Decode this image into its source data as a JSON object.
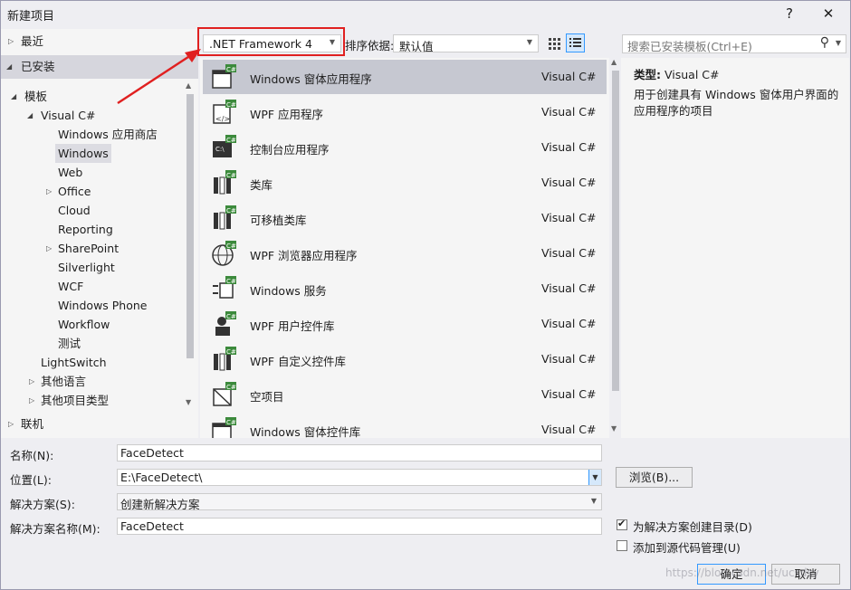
{
  "window": {
    "title": "新建项目",
    "help_label": "?",
    "close_label": "✕"
  },
  "tree": {
    "recent": "最近",
    "installed": "已安装",
    "templates": "模板",
    "visual_csharp": "Visual C#",
    "children": [
      "Windows 应用商店",
      "Windows",
      "Web",
      "Office",
      "Cloud",
      "Reporting",
      "SharePoint",
      "Silverlight",
      "WCF",
      "Windows Phone",
      "Workflow",
      "测试"
    ],
    "lightswitch": "LightSwitch",
    "other_languages": "其他语言",
    "other_project_types": "其他项目类型",
    "online": "联机"
  },
  "toolbar": {
    "framework": ".NET Framework 4",
    "sort_label": "排序依据:",
    "sort_value": "默认值",
    "search_placeholder": "搜索已安装模板(Ctrl+E)"
  },
  "templates": [
    {
      "name": "Windows 窗体应用程序",
      "lang": "Visual C#",
      "icon": "windows-forms-icon"
    },
    {
      "name": "WPF 应用程序",
      "lang": "Visual C#",
      "icon": "wpf-app-icon"
    },
    {
      "name": "控制台应用程序",
      "lang": "Visual C#",
      "icon": "console-app-icon"
    },
    {
      "name": "类库",
      "lang": "Visual C#",
      "icon": "class-library-icon"
    },
    {
      "name": "可移植类库",
      "lang": "Visual C#",
      "icon": "portable-library-icon"
    },
    {
      "name": "WPF 浏览器应用程序",
      "lang": "Visual C#",
      "icon": "wpf-browser-icon"
    },
    {
      "name": "Windows 服务",
      "lang": "Visual C#",
      "icon": "windows-service-icon"
    },
    {
      "name": "WPF 用户控件库",
      "lang": "Visual C#",
      "icon": "wpf-user-control-icon"
    },
    {
      "name": "WPF 自定义控件库",
      "lang": "Visual C#",
      "icon": "wpf-custom-control-icon"
    },
    {
      "name": "空项目",
      "lang": "Visual C#",
      "icon": "empty-project-icon"
    },
    {
      "name": "Windows 窗体控件库",
      "lang": "Visual C#",
      "icon": "forms-control-library-icon"
    }
  ],
  "details": {
    "type_label": "类型:",
    "type_value": "Visual C#",
    "description": "用于创建具有 Windows 窗体用户界面的应用程序的项目"
  },
  "form": {
    "name_label": "名称(N):",
    "name_value": "FaceDetect",
    "location_label": "位置(L):",
    "location_value": "E:\\FaceDetect\\",
    "browse_label": "浏览(B)...",
    "solution_label": "解决方案(S):",
    "solution_value": "创建新解决方案",
    "solution_name_label": "解决方案名称(M):",
    "solution_name_value": "FaceDetect",
    "create_dir_label": "为解决方案创建目录(D)",
    "create_dir_checked": true,
    "source_control_label": "添加到源代码管理(U)",
    "source_control_checked": false,
    "ok_label": "确定",
    "cancel_label": "取消"
  },
  "watermark": "https://blog.csdn.net/ucsdsy",
  "colors": {
    "highlight_red": "#e02020",
    "selected_row": "#c6c8d1",
    "csharp_badge": "#3c8a3c"
  }
}
